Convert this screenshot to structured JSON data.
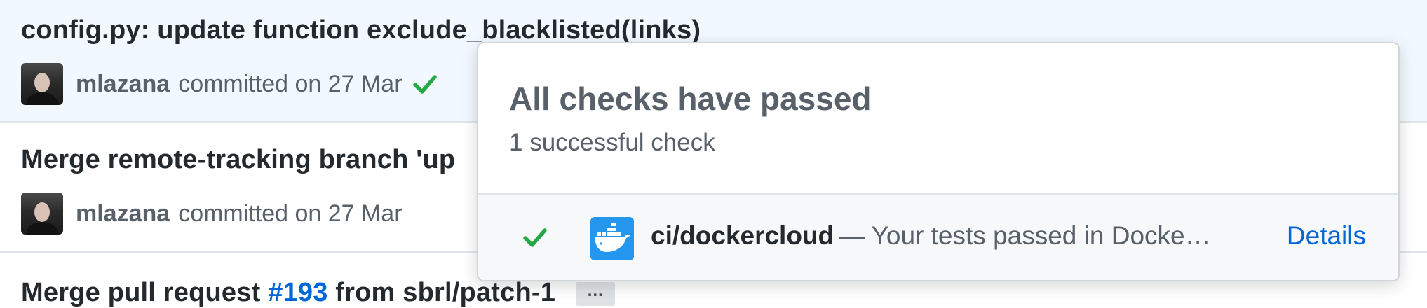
{
  "commits": [
    {
      "title": "config.py: update function exclude_blacklisted(links)",
      "author": "mlazana",
      "committed_text": "committed on 27 Mar",
      "status": "success"
    },
    {
      "title": "Merge remote-tracking branch 'up",
      "author": "mlazana",
      "committed_text": "committed on 27 Mar"
    },
    {
      "title_prefix": "Merge pull request ",
      "pr_link": "#193",
      "title_suffix": " from sbrl/patch-1",
      "ellipsis": "…"
    }
  ],
  "popover": {
    "title": "All checks have passed",
    "subtitle": "1 successful check",
    "check": {
      "name": "ci/dockercloud",
      "description": "— Your tests passed in Docke…",
      "details_label": "Details",
      "icon": "docker-icon"
    }
  },
  "colors": {
    "success": "#28a745",
    "link": "#0366d6",
    "docker": "#2496ed",
    "highlight_row": "#f1f8ff"
  }
}
